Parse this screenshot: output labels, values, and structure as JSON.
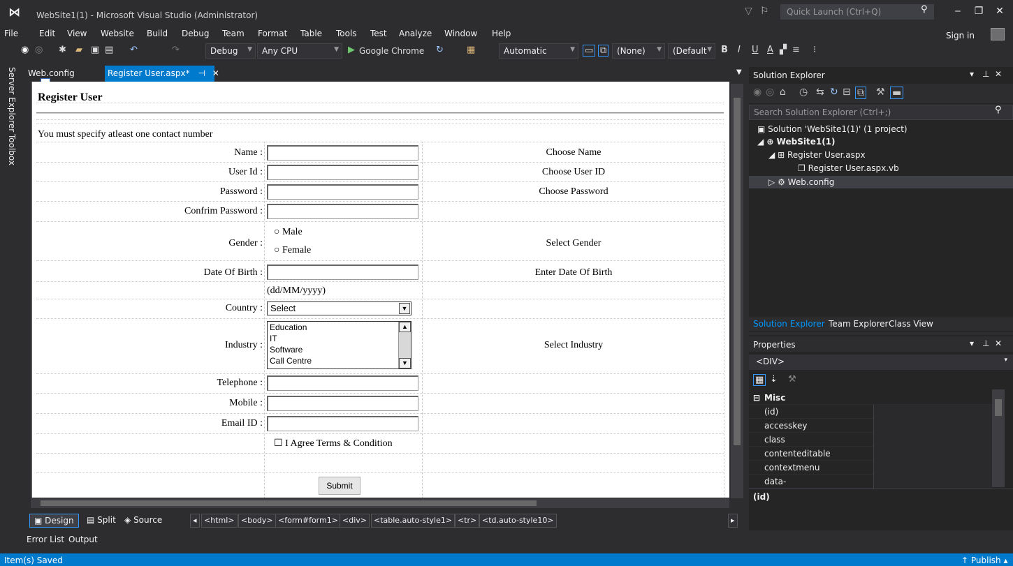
{
  "window": {
    "title": "WebSite1(1) - Microsoft Visual Studio (Administrator)",
    "quick_launch_placeholder": "Quick Launch (Ctrl+Q)",
    "min": "‒",
    "restore": "❐",
    "close": "✕"
  },
  "menu": [
    "File",
    "Edit",
    "View",
    "Website",
    "Build",
    "Debug",
    "Team",
    "Format",
    "Table",
    "Tools",
    "Test",
    "Analyze",
    "Window",
    "Help"
  ],
  "signin": "Sign in",
  "toolbar": {
    "config": "Debug",
    "platform": "Any CPU",
    "browser": "Google Chrome",
    "position": "Automatic",
    "css_class": "(None)",
    "font": "(Default",
    "bold": "B",
    "italic": "I",
    "underline": "U"
  },
  "side_tabs": [
    "Server Explorer",
    "Toolbox"
  ],
  "editor_tabs": [
    {
      "label": "Web.config",
      "active": false
    },
    {
      "label": "Register User.aspx*",
      "active": true
    }
  ],
  "form": {
    "heading": "Register User",
    "note": "You must specify atleast one contact number",
    "fields": [
      {
        "label": "Name :",
        "hint": "Choose Name"
      },
      {
        "label": "User Id :",
        "hint": "Choose User ID"
      },
      {
        "label": "Password :",
        "hint": "Choose Password"
      },
      {
        "label": "Confrim Password :",
        "hint": ""
      },
      {
        "label": "Gender :",
        "hint": "Select Gender"
      },
      {
        "label": "Date Of Birth :",
        "hint": "Enter Date Of Birth"
      },
      {
        "label": "Country :",
        "hint": ""
      },
      {
        "label": "Industry :",
        "hint": "Select Industry"
      },
      {
        "label": "Telephone :",
        "hint": ""
      },
      {
        "label": "Mobile :",
        "hint": ""
      },
      {
        "label": "Email ID :",
        "hint": ""
      }
    ],
    "gender_options": [
      "Male",
      "Female"
    ],
    "date_format": "(dd/MM/yyyy)",
    "country_selected": "Select",
    "industry_options": [
      "Education",
      "IT",
      "Software",
      "Call Centre"
    ],
    "agree_label": "I Agree Terms & Condition",
    "submit_label": "Submit"
  },
  "view_bar": {
    "design": "Design",
    "split": "Split",
    "source": "Source",
    "breadcrumbs": [
      "<html>",
      "<body>",
      "<form#form1>",
      "<div>",
      "<table.auto-style1>",
      "<tr>",
      "<td.auto-style10>"
    ]
  },
  "bottom_tabs": [
    "Error List",
    "Output"
  ],
  "status": {
    "text": "Item(s) Saved",
    "publish": "↑  Publish ▴"
  },
  "solution_explorer": {
    "title": "Solution Explorer",
    "search_placeholder": "Search Solution Explorer (Ctrl+;)",
    "tree": [
      {
        "label": "Solution 'WebSite1(1)' (1 project)"
      },
      {
        "label": "WebSite1(1)"
      },
      {
        "label": "Register User.aspx"
      },
      {
        "label": "Register User.aspx.vb"
      },
      {
        "label": "Web.config"
      }
    ],
    "tabs": [
      "Solution Explorer",
      "Team Explorer",
      "Class View"
    ]
  },
  "properties": {
    "title": "Properties",
    "object": "<DIV>",
    "category": "Misc",
    "rows": [
      "(id)",
      "accesskey",
      "class",
      "contenteditable",
      "contextmenu",
      "data-"
    ],
    "description_name": "(id)"
  },
  "colors": {
    "accent": "#007acc",
    "background": "#2d2d30",
    "panel": "#252526"
  }
}
